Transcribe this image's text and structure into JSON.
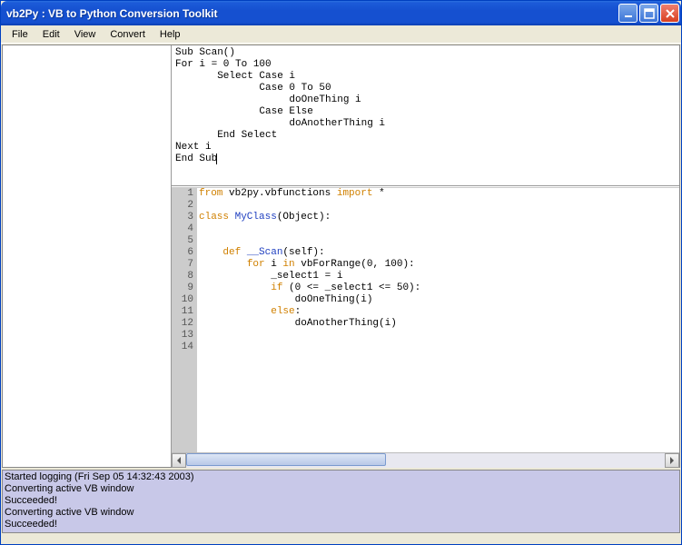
{
  "window": {
    "title": "vb2Py : VB to Python Conversion Toolkit"
  },
  "menu": {
    "items": [
      "File",
      "Edit",
      "View",
      "Convert",
      "Help"
    ]
  },
  "vb_editor": {
    "lines": [
      "Sub Scan()",
      "For i = 0 To 100",
      "       Select Case i",
      "              Case 0 To 50",
      "                   doOneThing i",
      "              Case Else",
      "                   doAnotherThing i",
      "       End Select",
      "Next i",
      "End Sub"
    ]
  },
  "py_editor": {
    "lines": [
      {
        "n": 1,
        "tokens": [
          {
            "t": "from ",
            "c": "orange"
          },
          {
            "t": "vb2py.vbfunctions ",
            "c": ""
          },
          {
            "t": "import ",
            "c": "orange"
          },
          {
            "t": "*",
            "c": ""
          }
        ]
      },
      {
        "n": 2,
        "tokens": []
      },
      {
        "n": 3,
        "tokens": [
          {
            "t": "class ",
            "c": "orange"
          },
          {
            "t": "MyClass",
            "c": "blue"
          },
          {
            "t": "(Object):",
            "c": ""
          }
        ]
      },
      {
        "n": 4,
        "tokens": []
      },
      {
        "n": 5,
        "tokens": []
      },
      {
        "n": 6,
        "tokens": [
          {
            "t": "    ",
            "c": ""
          },
          {
            "t": "def ",
            "c": "orange"
          },
          {
            "t": "__Scan",
            "c": "blue"
          },
          {
            "t": "(self):",
            "c": ""
          }
        ]
      },
      {
        "n": 7,
        "tokens": [
          {
            "t": "        ",
            "c": ""
          },
          {
            "t": "for ",
            "c": "orange"
          },
          {
            "t": "i ",
            "c": ""
          },
          {
            "t": "in ",
            "c": "orange"
          },
          {
            "t": "vbForRange(0, 100):",
            "c": ""
          }
        ]
      },
      {
        "n": 8,
        "tokens": [
          {
            "t": "            _select1 = i",
            "c": ""
          }
        ]
      },
      {
        "n": 9,
        "tokens": [
          {
            "t": "            ",
            "c": ""
          },
          {
            "t": "if ",
            "c": "orange"
          },
          {
            "t": "(0 <= _select1 <= 50):",
            "c": ""
          }
        ]
      },
      {
        "n": 10,
        "tokens": [
          {
            "t": "                doOneThing(i)",
            "c": ""
          }
        ]
      },
      {
        "n": 11,
        "tokens": [
          {
            "t": "            ",
            "c": ""
          },
          {
            "t": "else",
            "c": "orange"
          },
          {
            "t": ":",
            "c": ""
          }
        ]
      },
      {
        "n": 12,
        "tokens": [
          {
            "t": "                doAnotherThing(i)",
            "c": ""
          }
        ]
      },
      {
        "n": 13,
        "tokens": []
      },
      {
        "n": 14,
        "tokens": []
      }
    ]
  },
  "log": {
    "lines": [
      "Started logging (Fri Sep 05 14:32:43 2003)",
      "Converting active VB window",
      "Succeeded!",
      "Converting active VB window",
      "Succeeded!"
    ]
  }
}
